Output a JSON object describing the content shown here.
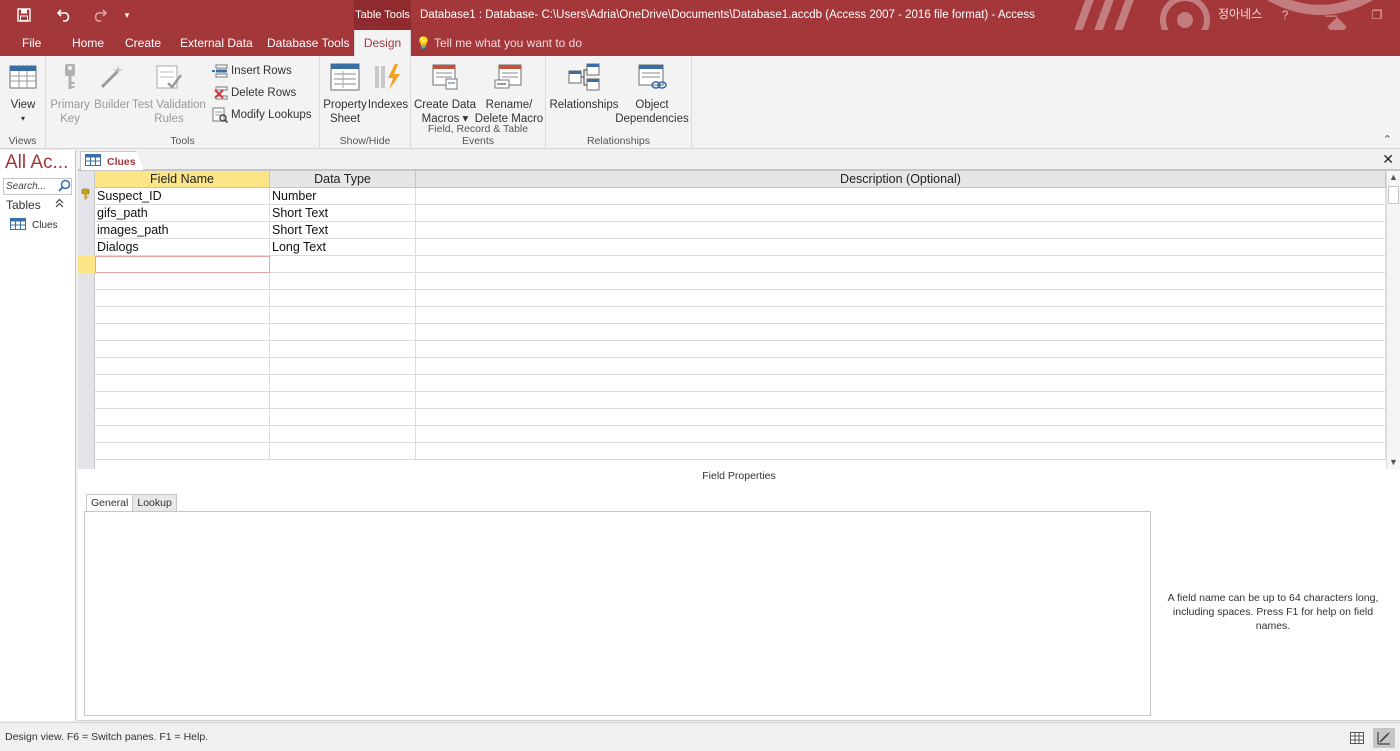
{
  "qat": {
    "save_icon": "save-icon",
    "undo_icon": "undo-icon",
    "redo_icon": "redo-icon",
    "customize_icon": "customize-qat-icon"
  },
  "title_bar": {
    "context_tab": "Table Tools",
    "window_title": "Database1 : Database- C:\\Users\\Adria\\OneDrive\\Documents\\Database1.accdb (Access 2007 - 2016 file format)  -  Access",
    "user": "정아네스",
    "help": "?",
    "minimize": "—",
    "restore": "❐",
    "accent_color": "#a4373a"
  },
  "tabs": [
    "File",
    "Home",
    "Create",
    "External Data",
    "Database Tools",
    "Design"
  ],
  "active_tab": "Design",
  "tell_me": "Tell me what you want to do",
  "ribbon": {
    "views": {
      "label": "Views",
      "view_btn": "View",
      "view_arrow": "▾"
    },
    "tools": {
      "label": "Tools",
      "primary_key": [
        "Primary",
        "Key"
      ],
      "builder": "Builder",
      "test_validation": [
        "Test Validation",
        "Rules"
      ],
      "insert_rows": "Insert Rows",
      "delete_rows": "Delete Rows",
      "modify_lookups": "Modify Lookups"
    },
    "show_hide": {
      "label": "Show/Hide",
      "property_sheet": [
        "Property",
        "Sheet"
      ],
      "indexes": "Indexes"
    },
    "events": {
      "label": "Field, Record & Table Events",
      "create_data_macros": [
        "Create Data",
        "Macros ▾"
      ],
      "rename_delete_macro": [
        "Rename/",
        "Delete Macro"
      ]
    },
    "relationships": {
      "label": "Relationships",
      "relationships": "Relationships",
      "object_dependencies": [
        "Object",
        "Dependencies"
      ]
    }
  },
  "nav": {
    "title": "All Ac...",
    "search_placeholder": "Search...",
    "group": "Tables",
    "items": [
      {
        "label": "Clues"
      }
    ]
  },
  "document": {
    "tab_label": "Clues",
    "columns": [
      "Field Name",
      "Data Type",
      "Description (Optional)"
    ],
    "rows": [
      {
        "field": "Suspect_ID",
        "type": "Number",
        "desc": "",
        "primary_key": true
      },
      {
        "field": "gifs_path",
        "type": "Short Text",
        "desc": ""
      },
      {
        "field": "images_path",
        "type": "Short Text",
        "desc": ""
      },
      {
        "field": "Dialogs",
        "type": "Long Text",
        "desc": ""
      }
    ],
    "field_properties_label": "Field Properties",
    "fp_tabs": [
      "General",
      "Lookup"
    ],
    "fp_active_tab": "General",
    "help_text": "A field name can be up to 64 characters long, including spaces. Press F1 for help on field names."
  },
  "status": {
    "text": "Design view.   F6 = Switch panes.   F1 = Help."
  }
}
